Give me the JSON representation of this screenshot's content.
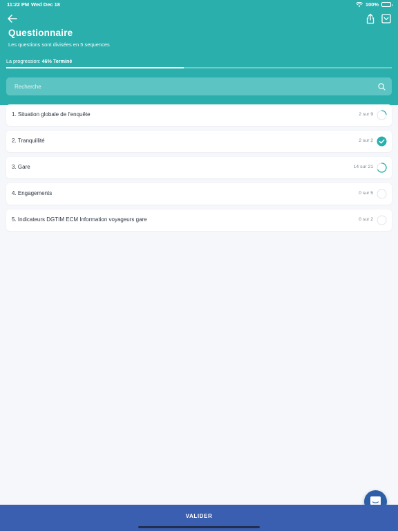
{
  "status_bar": {
    "time": "11:22 PM",
    "date": "Wed Dec 18",
    "battery": "100%"
  },
  "header": {
    "title": "Questionnaire",
    "subtitle": "Les questions sont divisées en 5 sequences",
    "progress_prefix": "La progression:",
    "progress_value": "46% Terminé",
    "progress_fraction": 0.46
  },
  "search": {
    "placeholder": "Recherche"
  },
  "sections": [
    {
      "label": "1. Situation globale de l'enquête",
      "count": "2 sur 9",
      "answered": 2,
      "total": 9
    },
    {
      "label": "2. Tranquillité",
      "count": "2 sur 2",
      "answered": 2,
      "total": 2
    },
    {
      "label": "3. Gare",
      "count": "14 sur 21",
      "answered": 14,
      "total": 21
    },
    {
      "label": "4. Engagements",
      "count": "0 sur 5",
      "answered": 0,
      "total": 5
    },
    {
      "label": "5. Indicateurs DGTIM ECM Information voyageurs gare",
      "count": "0 sur 2",
      "answered": 0,
      "total": 2
    }
  ],
  "footer": {
    "submit_label": "VALIDER"
  },
  "colors": {
    "header": "#2bafad",
    "accent": "#2bafad",
    "footer": "#3a5fb0",
    "chat": "#2d5fa8"
  },
  "icons": [
    "back-arrow-icon",
    "share-icon",
    "dropdown-box-icon",
    "search-icon",
    "check-icon",
    "progress-ring-icon",
    "chat-icon",
    "wifi-icon",
    "battery-icon"
  ]
}
